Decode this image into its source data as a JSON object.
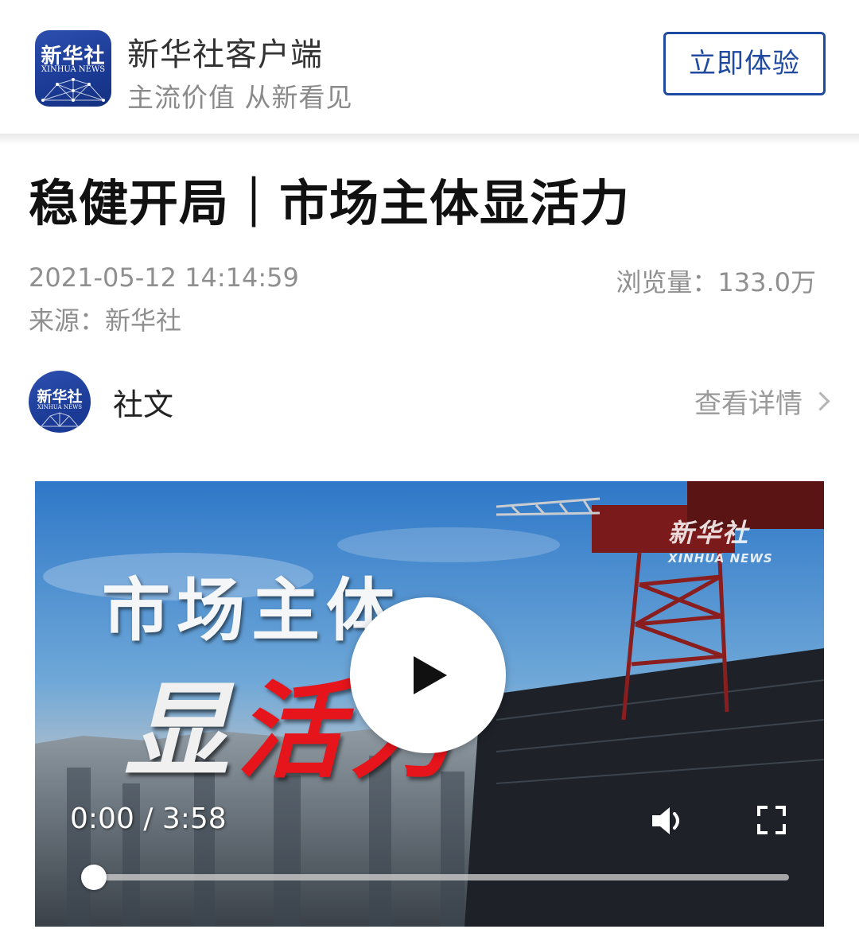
{
  "banner": {
    "logo_cn": "新华社",
    "logo_en": "XINHUA NEWS",
    "app_name": "新华社客户端",
    "slogan": "主流价值 从新看见",
    "cta_label": "立即体验",
    "brand_color": "#1f4aa0"
  },
  "article": {
    "title": "稳健开局｜市场主体显活力",
    "publish_time": "2021-05-12 14:14:59",
    "views_label": "浏览量：",
    "views_value": "133.0万",
    "source_label": "来源：",
    "source_value": "新华社"
  },
  "author": {
    "avatar_cn": "新华社",
    "avatar_en": "XINHUA NEWS",
    "name": "社文",
    "detail_label": "查看详情"
  },
  "video": {
    "watermark_cn": "新华社",
    "watermark_en": "XINHUA NEWS",
    "overlay_line1": "市场主体",
    "overlay_line2_white": "显",
    "overlay_line2_red": "活力",
    "time": "0:00 / 3:58",
    "progress": 0,
    "icons": {
      "play": "play-icon",
      "volume": "volume-icon",
      "fullscreen": "fullscreen-icon"
    }
  }
}
